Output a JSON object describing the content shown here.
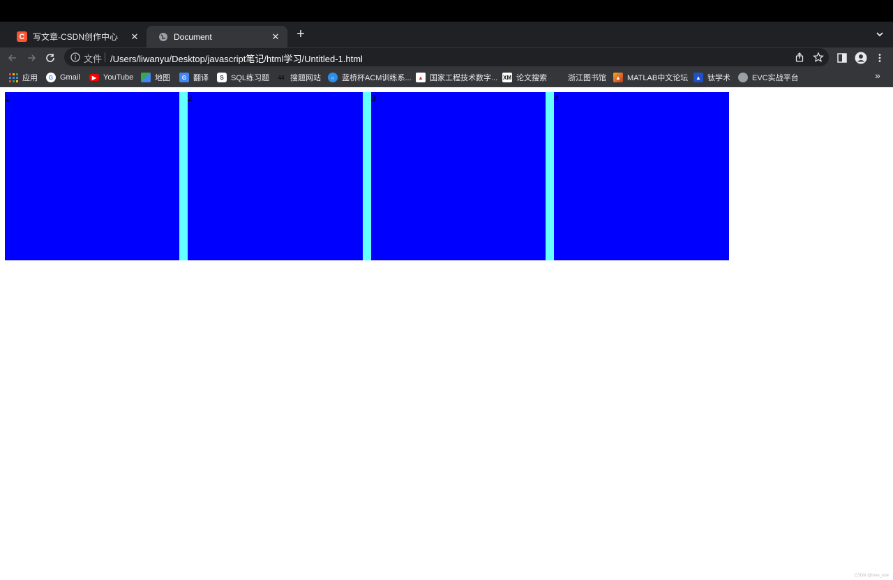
{
  "window": {
    "tabs": [
      {
        "title": "写文章-CSDN创作中心",
        "active": false,
        "favicon": "csdn-logo-icon",
        "favicon_color": "#fc5531"
      },
      {
        "title": "Document",
        "active": true,
        "favicon": "globe-icon"
      }
    ]
  },
  "toolbar": {
    "scheme_label": "文件",
    "url": "/Users/liwanyu/Desktop/javascript笔记/html学习/Untitled-1.html"
  },
  "bookmarks": [
    {
      "label": "应用",
      "icon": "apps-grid-icon"
    },
    {
      "label": "Gmail",
      "icon": "google-icon"
    },
    {
      "label": "YouTube",
      "icon": "youtube-icon"
    },
    {
      "label": "地图",
      "icon": "maps-icon"
    },
    {
      "label": "翻译",
      "icon": "translate-icon"
    },
    {
      "label": "SQL练习题",
      "icon": "sql-icon"
    },
    {
      "label": "搜题网站",
      "icon": "search-site-icon"
    },
    {
      "label": "蓝桥杯ACM训练系...",
      "icon": "lanqiao-icon"
    },
    {
      "label": "国家工程技术数字...",
      "icon": "chart-book-icon"
    },
    {
      "label": "论文搜索",
      "icon": "xmol-icon"
    },
    {
      "label": "浙江图书馆",
      "icon": "library-icon"
    },
    {
      "label": "MATLAB中文论坛",
      "icon": "matlab-icon"
    },
    {
      "label": "钛学术",
      "icon": "graduation-cap-icon"
    },
    {
      "label": "EVC实战平台",
      "icon": "globe-icon"
    }
  ],
  "page": {
    "boxes": [
      {
        "label": "1"
      },
      {
        "label": "2"
      },
      {
        "label": "3"
      },
      {
        "label": "4"
      }
    ],
    "box_color": "#0000ff",
    "gap_color": "#66ffff"
  },
  "watermark": "CSDN @lone_one"
}
